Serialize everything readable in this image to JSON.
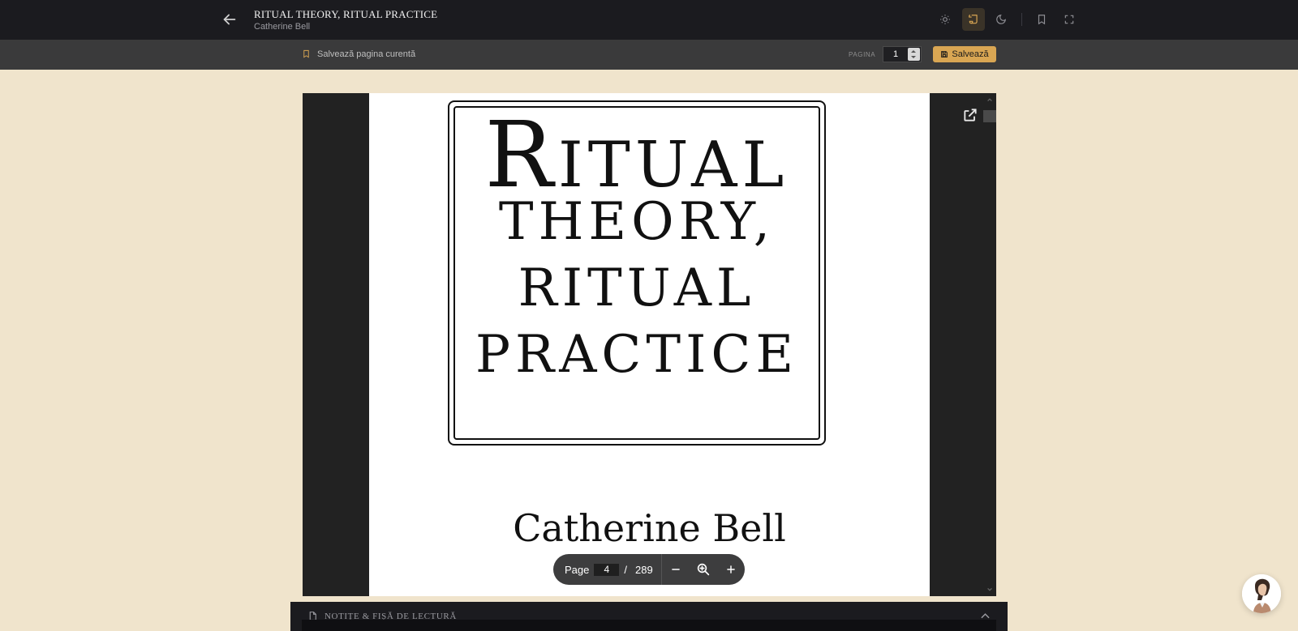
{
  "header": {
    "title": "RITUAL THEORY, RITUAL PRACTICE",
    "author": "Catherine Bell",
    "icons": [
      "arrow-left-icon",
      "sun-icon",
      "scroll-icon",
      "moon-icon",
      "bookmark-icon",
      "fullscreen-icon"
    ]
  },
  "subbar": {
    "save_current_label": "Salvează pagina curentă",
    "page_label": "PAGINA",
    "page_value": "1",
    "save_label": "Salvează"
  },
  "pdf": {
    "title_lines": [
      "Ritual",
      "THEORY,",
      "RITUAL",
      "PRACTICE"
    ],
    "author": "Catherine Bell"
  },
  "page_toolbar": {
    "page_label": "Page",
    "current_page": "4",
    "separator": "/",
    "total_pages": "289"
  },
  "notes": {
    "title": "NOTIȚE & FIȘĂ DE LECTURĂ"
  },
  "colors": {
    "background": "#f0e4cc",
    "topbar": "#1b1b1f",
    "accent": "#d9a653"
  }
}
